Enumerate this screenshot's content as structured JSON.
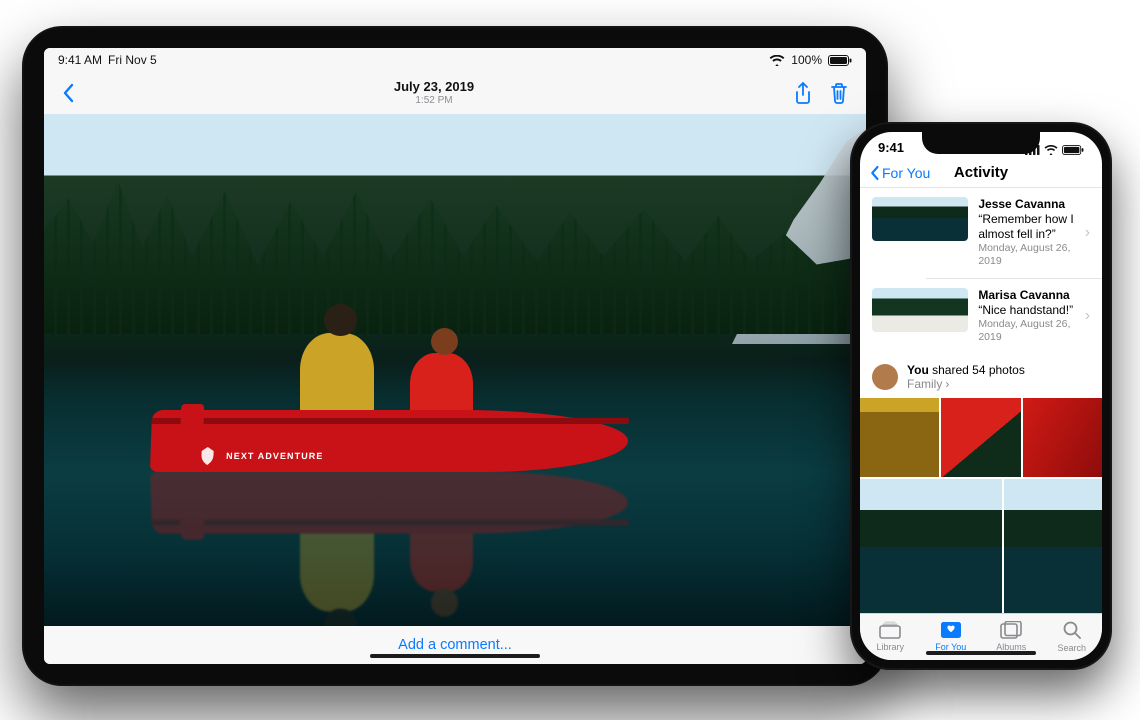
{
  "ipad": {
    "status": {
      "time": "9:41 AM",
      "date": "Fri Nov 5",
      "battery": "100%"
    },
    "photo_header": {
      "date": "July 23, 2019",
      "time": "1:52 PM"
    },
    "canoe_badge": "NEXT ADVENTURE",
    "add_comment": "Add a comment..."
  },
  "iphone": {
    "status": {
      "time": "9:41"
    },
    "nav": {
      "back": "For You",
      "title": "Activity"
    },
    "activity": [
      {
        "name": "Jesse Cavanna",
        "message": "“Remember how I almost fell in?”",
        "date": "Monday, August 26, 2019"
      },
      {
        "name": "Marisa Cavanna",
        "message": "“Nice handstand!”",
        "date": "Monday, August 26, 2019"
      }
    ],
    "shared": {
      "you_label": "You",
      "text": " shared 54 photos",
      "album": "Family"
    },
    "tabs": [
      {
        "label": "Library",
        "active": false
      },
      {
        "label": "For You",
        "active": true
      },
      {
        "label": "Albums",
        "active": false
      },
      {
        "label": "Search",
        "active": false
      }
    ]
  },
  "colors": {
    "accent": "#0a7aff"
  }
}
